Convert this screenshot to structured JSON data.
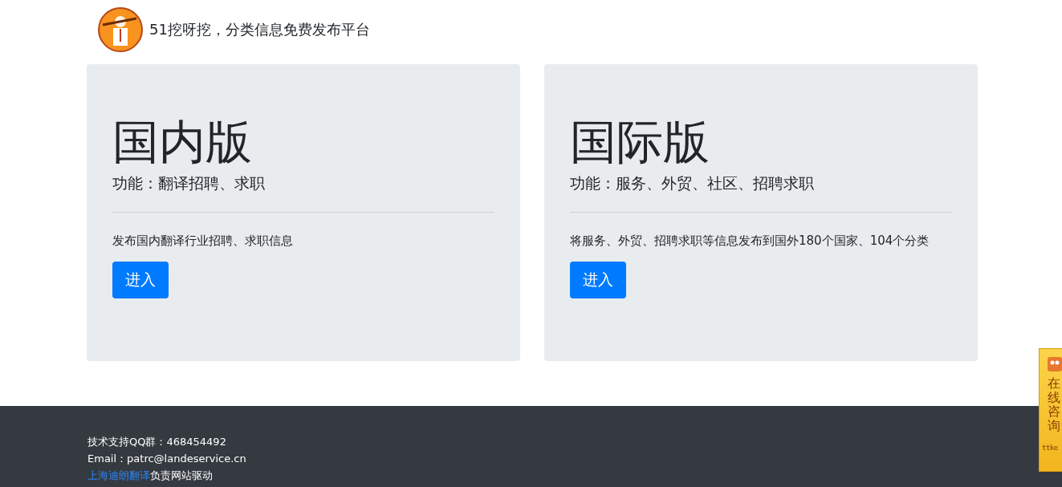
{
  "header": {
    "site_title": "51挖呀挖，分类信息免费发布平台"
  },
  "cards": [
    {
      "title": "国内版",
      "subtitle": "功能：翻译招聘、求职",
      "description": "发布国内翻译行业招聘、求职信息",
      "button": "进入"
    },
    {
      "title": "国际版",
      "subtitle": "功能：服务、外贸、社区、招聘求职",
      "description": "将服务、外贸、招聘求职等信息发布到国外180个国家、104个分类",
      "button": "进入"
    }
  ],
  "footer": {
    "qq": "技术支持QQ群：468454492",
    "email": "Email：patrc@landeservice.cn",
    "credit_link": "上海迪朗翻译",
    "credit_text": "负责网站驱动"
  },
  "chat_widget": {
    "label": "在线咨询",
    "brand": "ttke"
  }
}
